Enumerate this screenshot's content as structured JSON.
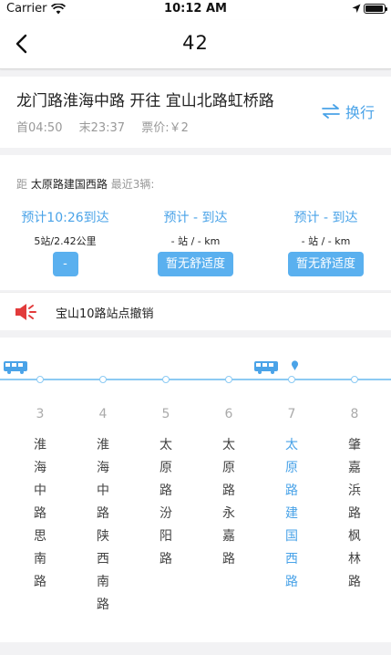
{
  "status_bar": {
    "carrier": "Carrier",
    "time": "10:12 AM"
  },
  "nav": {
    "title": "42"
  },
  "route": {
    "name": "龙门路淮海中路 开往 宜山北路虹桥路",
    "first": "首04:50",
    "last": "末23:37",
    "price": "票价:￥2",
    "switch_label": "换行"
  },
  "arrivals": {
    "distance_prefix": "距",
    "stop_name": "太原路建国西路",
    "distance_suffix": "最近3辆:",
    "buses": [
      {
        "eta": "预计10:26到达",
        "info": "5站/2.42公里",
        "button": "-"
      },
      {
        "eta": "预计 - 到达",
        "info": "- 站 / - km",
        "button": "暂无舒适度"
      },
      {
        "eta": "预计 - 到达",
        "info": "- 站 / - km",
        "button": "暂无舒适度"
      }
    ]
  },
  "notice": {
    "text": "宝山10路站点撤销"
  },
  "stations": [
    {
      "num": "3",
      "name": "淮海中路思南路"
    },
    {
      "num": "4",
      "name": "淮海中路陕西南路"
    },
    {
      "num": "5",
      "name": "太原路汾阳路"
    },
    {
      "num": "6",
      "name": "太原路永嘉路"
    },
    {
      "num": "7",
      "name": "太原路建国西路",
      "current": true
    },
    {
      "num": "8",
      "name": "肇嘉浜路枫林路"
    }
  ],
  "colors": {
    "accent": "#4aa3e8",
    "button": "#5ab0ef",
    "alert": "#e23b3b"
  }
}
